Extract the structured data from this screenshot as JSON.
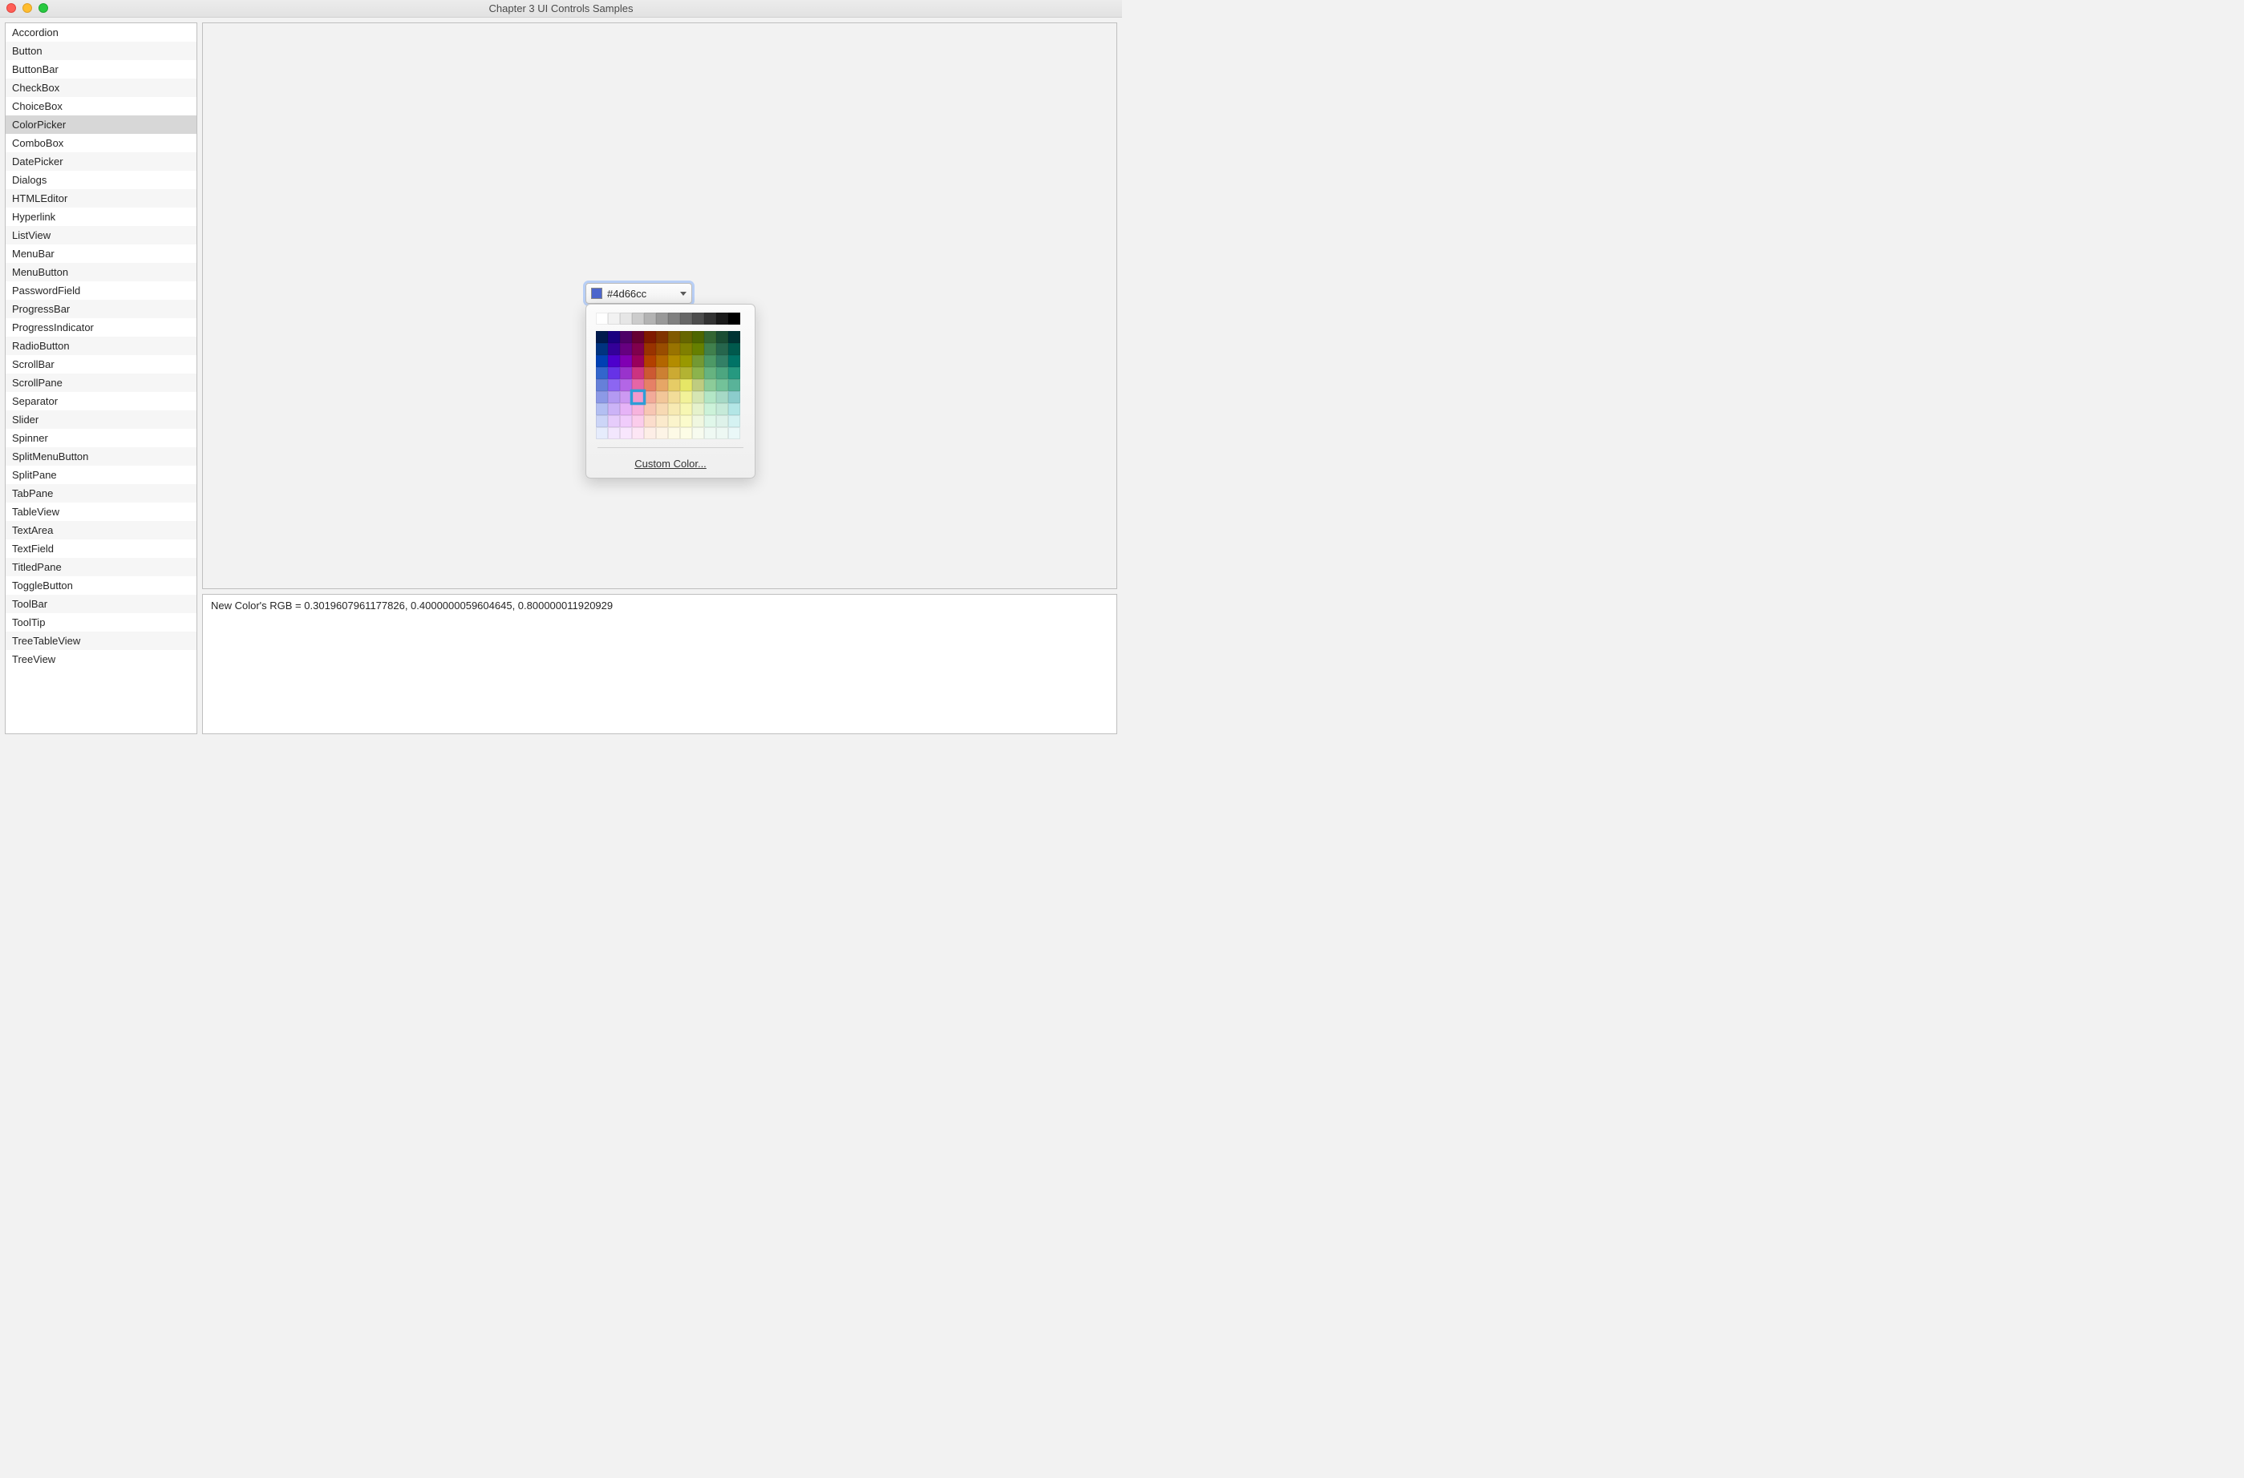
{
  "window": {
    "title": "Chapter 3 UI Controls Samples"
  },
  "sidebar": {
    "selected_index": 5,
    "items": [
      "Accordion",
      "Button",
      "ButtonBar",
      "CheckBox",
      "ChoiceBox",
      "ColorPicker",
      "ComboBox",
      "DatePicker",
      "Dialogs",
      "HTMLEditor",
      "Hyperlink",
      "ListView",
      "MenuBar",
      "MenuButton",
      "PasswordField",
      "ProgressBar",
      "ProgressIndicator",
      "RadioButton",
      "ScrollBar",
      "ScrollPane",
      "Separator",
      "Slider",
      "Spinner",
      "SplitMenuButton",
      "SplitPane",
      "TabPane",
      "TableView",
      "TextArea",
      "TextField",
      "TitledPane",
      "ToggleButton",
      "ToolBar",
      "ToolTip",
      "TreeTableView",
      "TreeView"
    ]
  },
  "colorpicker": {
    "current_label": "#4d66cc",
    "current_hex": "#4d66cc",
    "custom_link": "Custom Color...",
    "palette_top_row": [
      "#ffffff",
      "#f2f2f2",
      "#e6e6e6",
      "#cccccc",
      "#b3b3b3",
      "#999999",
      "#808080",
      "#666666",
      "#4d4d4d",
      "#333333",
      "#1a1a1a",
      "#000000"
    ],
    "palette_hues": [
      "#001a4d",
      "#1a0080",
      "#4d0066",
      "#660033",
      "#801a00",
      "#803300",
      "#805900",
      "#666600",
      "#4d6600",
      "#336633",
      "#1a4d33",
      "#003333",
      "#003380",
      "#330099",
      "#660080",
      "#80004d",
      "#993300",
      "#994d00",
      "#997300",
      "#808000",
      "#668000",
      "#40804d",
      "#26664d",
      "#00594d",
      "#0040b3",
      "#4d00cc",
      "#8000b3",
      "#99005c",
      "#b34000",
      "#b36600",
      "#b38c00",
      "#999900",
      "#739933",
      "#4d9966",
      "#338066",
      "#007366",
      "#3366cc",
      "#6633e6",
      "#9933cc",
      "#cc3380",
      "#cc5933",
      "#cc8033",
      "#ccaa33",
      "#b3b333",
      "#8cb34d",
      "#66b380",
      "#4da680",
      "#269980",
      "#6680d9",
      "#8c66f2",
      "#b366e6",
      "#e666a6",
      "#e68066",
      "#e6a666",
      "#e6cc66",
      "#e6e666",
      "#bfcc80",
      "#8ccc99",
      "#73c299",
      "#59b399",
      "#8c99e6",
      "#b399f2",
      "#cc99f2",
      "#f299cc",
      "#f2aa99",
      "#f2c699",
      "#f2dd99",
      "#f2f299",
      "#d6e6b3",
      "#b3e6c6",
      "#a6d9c6",
      "#8ccccc",
      "#b3bff2",
      "#ccb3f7",
      "#e6b3f7",
      "#f7b3dd",
      "#f7c6b3",
      "#f7d9b3",
      "#f7eab3",
      "#f7f7b3",
      "#e6f2cc",
      "#ccf2d9",
      "#c6ead9",
      "#b3e6e6",
      "#ccd5f7",
      "#e6ccfb",
      "#f0ccfb",
      "#fbcceb",
      "#fbddcc",
      "#fbeacc",
      "#fbf4cc",
      "#fbfbcc",
      "#f0f7e0",
      "#e0f7ea",
      "#def2ea",
      "#d5f2f2",
      "#e6ecfc",
      "#f2e6fd",
      "#f8e6fd",
      "#fde6f5",
      "#fdeee6",
      "#fdf4e6",
      "#fdfae6",
      "#fdfde6",
      "#f7fbef",
      "#eff9f3",
      "#edf8f3",
      "#eaf8f8"
    ],
    "selected_palette_index": 63
  },
  "status": {
    "text": "New Color's RGB = 0.3019607961177826, 0.4000000059604645, 0.800000011920929"
  }
}
